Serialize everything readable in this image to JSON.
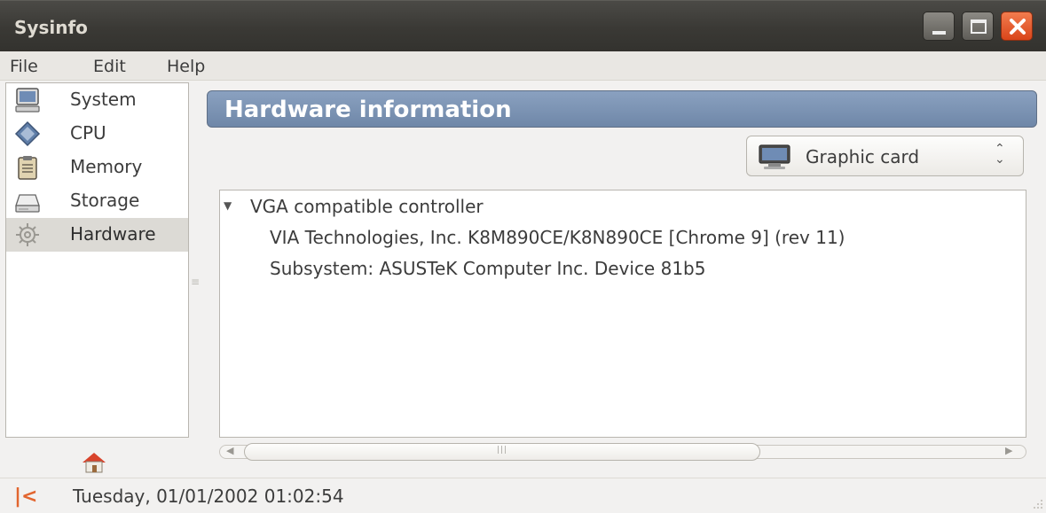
{
  "window": {
    "title": "Sysinfo",
    "controls": [
      "minimize",
      "maximize",
      "close"
    ]
  },
  "menubar": {
    "file": "File",
    "edit": "Edit",
    "help": "Help"
  },
  "sidebar": {
    "items": [
      {
        "label": "System",
        "icon": "monitor-icon",
        "selected": false
      },
      {
        "label": "CPU",
        "icon": "cpu-chip-icon",
        "selected": false
      },
      {
        "label": "Memory",
        "icon": "clipboard-memory-icon",
        "selected": false
      },
      {
        "label": "Storage",
        "icon": "drive-icon",
        "selected": false
      },
      {
        "label": "Hardware",
        "icon": "gear-icon",
        "selected": true
      }
    ],
    "home_icon": "home-icon"
  },
  "main": {
    "header_title": "Hardware information",
    "device_select": {
      "selected": "Graphic card",
      "icon": "monitor-icon"
    },
    "tree": {
      "parent": "VGA compatible controller",
      "expanded": true,
      "children": [
        "VIA Technologies, Inc. K8M890CE/K8N890CE [Chrome 9] (rev 11)",
        "Subsystem: ASUSTeK Computer Inc. Device 81b5"
      ]
    }
  },
  "statusbar": {
    "text": "Tuesday, 01/01/2002 01:02:54",
    "prev_icon": "skip-back-icon"
  },
  "colors": {
    "titlebar": "#3c3b37",
    "header_bar": "#7b92b2",
    "close_button": "#e5562a",
    "accent_orange": "#e2652f",
    "selected_row": "#dcdad5"
  }
}
